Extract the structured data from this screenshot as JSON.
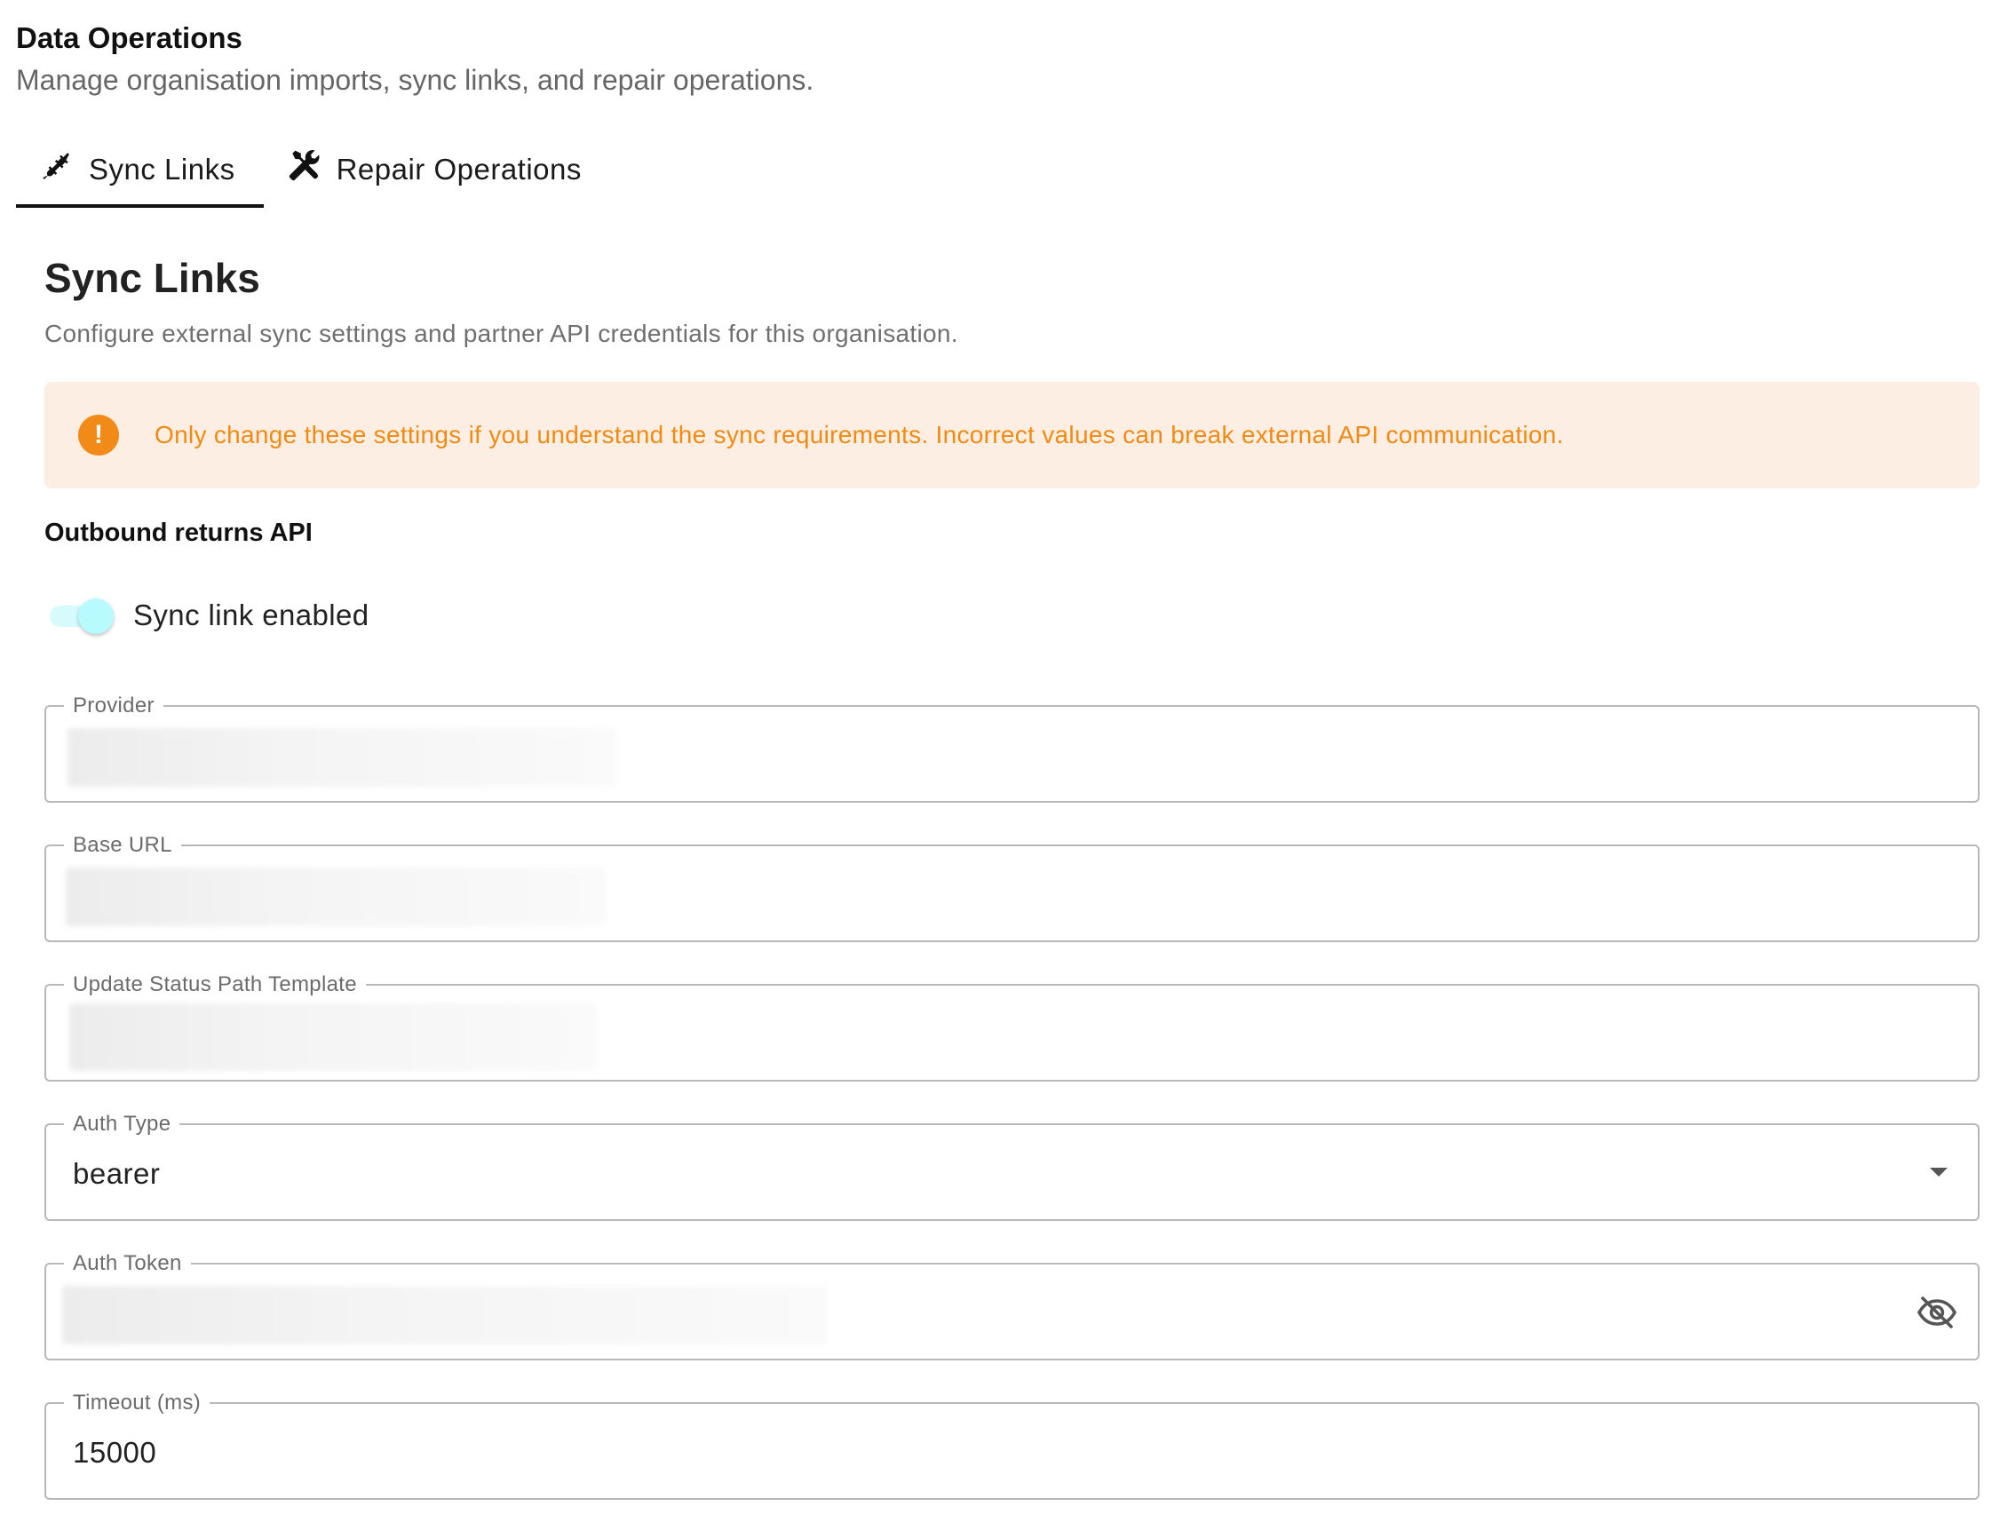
{
  "header": {
    "title": "Data Operations",
    "subtitle": "Manage organisation imports, sync links, and repair operations."
  },
  "tabs": [
    {
      "label": "Sync Links",
      "icon": "plug-icon",
      "active": true
    },
    {
      "label": "Repair Operations",
      "icon": "wrench-screwdriver-icon",
      "active": false
    }
  ],
  "section": {
    "title": "Sync Links",
    "description": "Configure external sync settings and partner API credentials for this organisation."
  },
  "alert": {
    "icon": "warning-icon",
    "text": "Only change these settings if you understand the sync requirements. Incorrect values can break external API communication.",
    "color": "#ef8a12",
    "background": "#fdeee4"
  },
  "group": {
    "label": "Outbound returns API"
  },
  "toggle": {
    "label": "Sync link enabled",
    "enabled": true
  },
  "fields": {
    "provider": {
      "label": "Provider",
      "value": ""
    },
    "base_url": {
      "label": "Base URL",
      "value": ""
    },
    "update_status_path": {
      "label": "Update Status Path Template",
      "value": ""
    },
    "auth_type": {
      "label": "Auth Type",
      "value": "bearer"
    },
    "auth_token": {
      "label": "Auth Token",
      "value": "",
      "icon": "eye-off-icon"
    },
    "timeout": {
      "label": "Timeout (ms)",
      "value": "15000"
    }
  }
}
